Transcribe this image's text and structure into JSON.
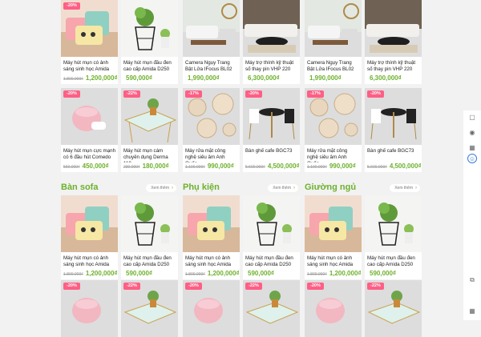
{
  "products": {
    "p1": {
      "name": "Máy hút mụn có ảnh sáng sinh học Amida",
      "old": "1.800.000₫",
      "new": "1,200,000₫",
      "badge": "-20%"
    },
    "p2": {
      "name": "Máy hút mụn đầu đen cao cấp Amida D250",
      "old": "",
      "new": "590,000₫",
      "badge": ""
    },
    "p3": {
      "name": "Camera Ngụy Trang Bật Lửa IFocus BL02",
      "old": "",
      "new": "1,990,000₫",
      "badge": ""
    },
    "p4": {
      "name": "Máy trợ thính kỹ thuật số thay pin VHP 220",
      "old": "",
      "new": "6,300,000₫",
      "badge": ""
    },
    "p5": {
      "name": "Máy hút mụn cực mạnh có 6 đầu hút Comedo",
      "old": "560.000₫",
      "new": "450,000₫",
      "badge": "-20%"
    },
    "p6": {
      "name": "Máy hút mụn cám chuyên dụng Derma 110",
      "old": "230.000₫",
      "new": "180,000₫",
      "badge": "-22%"
    },
    "p7": {
      "name": "Máy rửa mặt công nghệ siêu âm Anh Quốc",
      "old": "1.190.000₫",
      "new": "990,000₫",
      "badge": "-17%"
    },
    "p8": {
      "name": "Bàn ghế cafe BGC73",
      "old": "5.600.000₫",
      "new": "4,500,000₫",
      "badge": "-20%"
    }
  },
  "sections": {
    "sofa": "Bàn sofa",
    "phukien": "Phụ kiện",
    "giuongngu": "Giường ngủ",
    "more_label": "Xem thêm"
  },
  "icons": [
    "book-icon",
    "support-icon",
    "grid-icon",
    "face-icon",
    "copy-icon",
    "grid-icon"
  ],
  "colors": {
    "accent": "#6db12c",
    "badge": "#ff5f85"
  }
}
